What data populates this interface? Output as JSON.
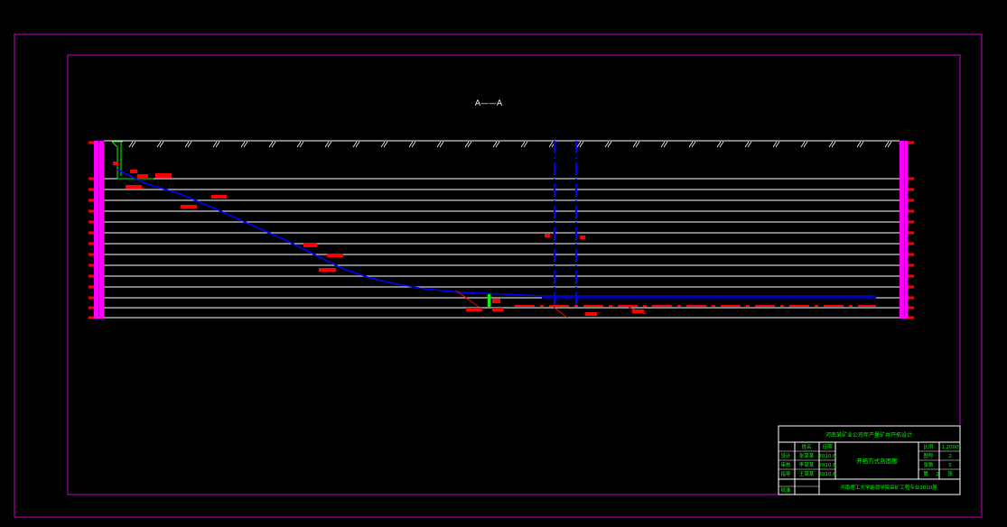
{
  "drawing": {
    "section_label": "A——A",
    "title_block": {
      "project_title": "河南某矿业公司年产量矿井开拓设计",
      "drawing_title": "开拓方式剖面图",
      "header_row": [
        "姓名",
        "日期"
      ],
      "rows": [
        {
          "role": "设计",
          "name": "张某某",
          "date": "2010.6"
        },
        {
          "role": "审核",
          "name": "李某某",
          "date": "2010.6"
        },
        {
          "role": "指导",
          "name": "王某某",
          "date": "2010.6"
        }
      ],
      "approve_label": "批准",
      "right_rows": [
        {
          "label": "比例",
          "value": "1:2000"
        },
        {
          "label": "图号",
          "value": "2"
        },
        {
          "label": "张数",
          "value": "5"
        },
        {
          "label": "第",
          "value": "2",
          "suffix": "张"
        }
      ],
      "school": "河南理工大学能源学院采矿工程专业2010届"
    },
    "colors": {
      "frame": "#cc00cc",
      "grid": "#ffffff",
      "seam": "#0000ff",
      "label": "#ff0000",
      "title_block": "#00ff00",
      "hatch": "#ffffff"
    }
  }
}
